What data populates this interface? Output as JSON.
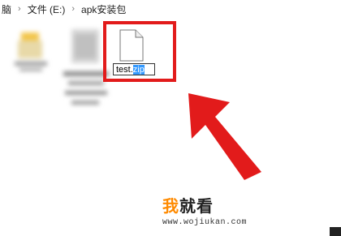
{
  "breadcrumb": {
    "items": [
      "脑",
      "文件 (E:)",
      "apk安装包"
    ],
    "separator": "›"
  },
  "files": {
    "rename_value_base": "test.",
    "rename_value_selected": "zip"
  },
  "watermark": {
    "logo_text_first": "我",
    "logo_text_rest": "就看",
    "url": "www.wojiukan.com"
  },
  "colors": {
    "highlight_box": "#e21b1b",
    "arrow": "#e21b1b",
    "selection": "#3399ff",
    "logo_accent": "#ff8a00"
  }
}
